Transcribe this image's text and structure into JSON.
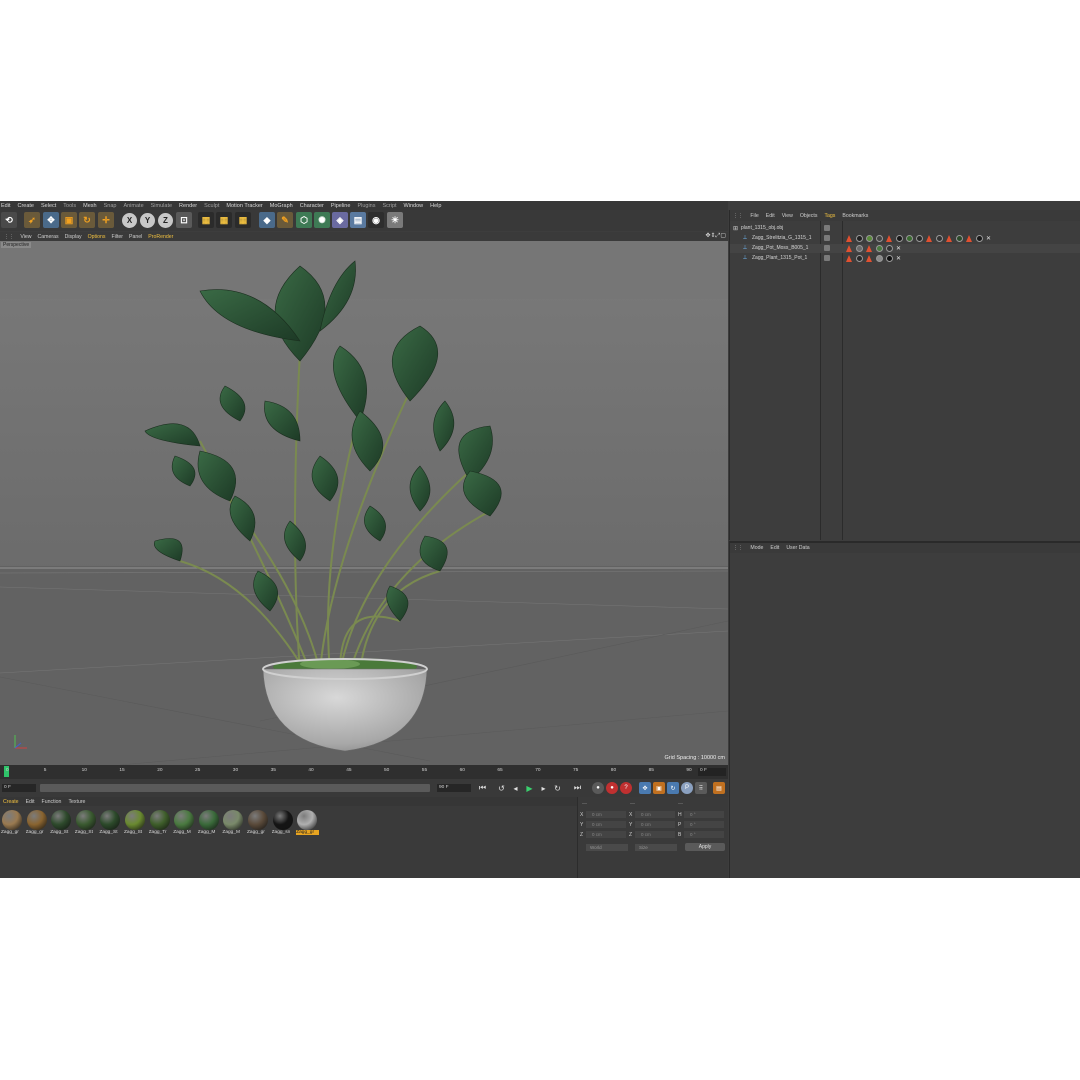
{
  "main_menu": [
    "Edit",
    "Create",
    "Select",
    "Tools",
    "Mesh",
    "Snap",
    "Animate",
    "Simulate",
    "Render",
    "Sculpt",
    "Motion Tracker",
    "MoGraph",
    "Character",
    "Pipeline",
    "Plugins",
    "Script",
    "Window",
    "Help"
  ],
  "toolbar": {
    "axis_x": "X",
    "axis_y": "Y",
    "axis_z": "Z"
  },
  "viewport_menu": [
    "View",
    "Cameras",
    "Display",
    "Options",
    "Filter",
    "Panel",
    "ProRender"
  ],
  "viewport_menu_active": [
    "Options",
    "ProRender"
  ],
  "viewport": {
    "label": "Perspective",
    "grid_spacing": "Grid Spacing : 10000 cm"
  },
  "timeline": {
    "ticks": [
      "0",
      "5",
      "10",
      "15",
      "20",
      "25",
      "30",
      "35",
      "40",
      "45",
      "50",
      "55",
      "60",
      "65",
      "70",
      "75",
      "80",
      "85",
      "90"
    ],
    "end_frame": "0 F"
  },
  "transport": {
    "current_frame": "0 F",
    "range_end": "90 F",
    "range_end_small": "90 F"
  },
  "material_panel": {
    "menu": [
      "Create",
      "Edit",
      "Function",
      "Texture"
    ],
    "materials": [
      {
        "label": "Zagg_gr",
        "color": "#9a7a50"
      },
      {
        "label": "Zagg_gr",
        "color": "#8a6430"
      },
      {
        "label": "Zagg_St",
        "color": "#2e4a2c"
      },
      {
        "label": "Zagg_St",
        "color": "#3a5a30"
      },
      {
        "label": "Zagg_St",
        "color": "#2c4a2a"
      },
      {
        "label": "Zagg_St",
        "color": "#6a8a30"
      },
      {
        "label": "Zagg_Tr",
        "color": "#3e5e2a"
      },
      {
        "label": "Zagg_M",
        "color": "#4a7a40"
      },
      {
        "label": "Zagg_M",
        "color": "#3a6a3a"
      },
      {
        "label": "Zagg_M",
        "color": "#7a8a6a"
      },
      {
        "label": "Zagg_gr",
        "color": "#5a4a3a"
      },
      {
        "label": "Zagg_sn",
        "color": "#151515"
      },
      {
        "label": "Zagg_gr",
        "color": "#b0b0b0"
      }
    ]
  },
  "coordinates": {
    "rows": [
      {
        "axis": "X",
        "pos": "0 cm",
        "size_axis": "X",
        "size": "0 cm",
        "rot_axis": "H",
        "rot": "0 °"
      },
      {
        "axis": "Y",
        "pos": "0 cm",
        "size_axis": "Y",
        "size": "0 cm",
        "rot_axis": "P",
        "rot": "0 °"
      },
      {
        "axis": "Z",
        "pos": "0 cm",
        "size_axis": "Z",
        "size": "0 cm",
        "rot_axis": "B",
        "rot": "0 °"
      }
    ],
    "mode_select": "World",
    "size_select": "Size",
    "apply_label": "Apply"
  },
  "objects_panel": {
    "menu": [
      "File",
      "Edit",
      "View",
      "Objects",
      "Tags",
      "Bookmarks"
    ],
    "active_menu": "Tags",
    "objects": [
      {
        "name": "plant_1315_obj.obj",
        "level": 0
      },
      {
        "name": "Zagg_Strelitzia_G_1315_1",
        "level": 1
      },
      {
        "name": "Zagg_Pot_Moss_B005_1",
        "level": 1
      },
      {
        "name": "Zagg_Plant_1315_Pot_1",
        "level": 1
      }
    ]
  },
  "attributes_panel": {
    "menu": [
      "Mode",
      "Edit",
      "User Data"
    ]
  }
}
